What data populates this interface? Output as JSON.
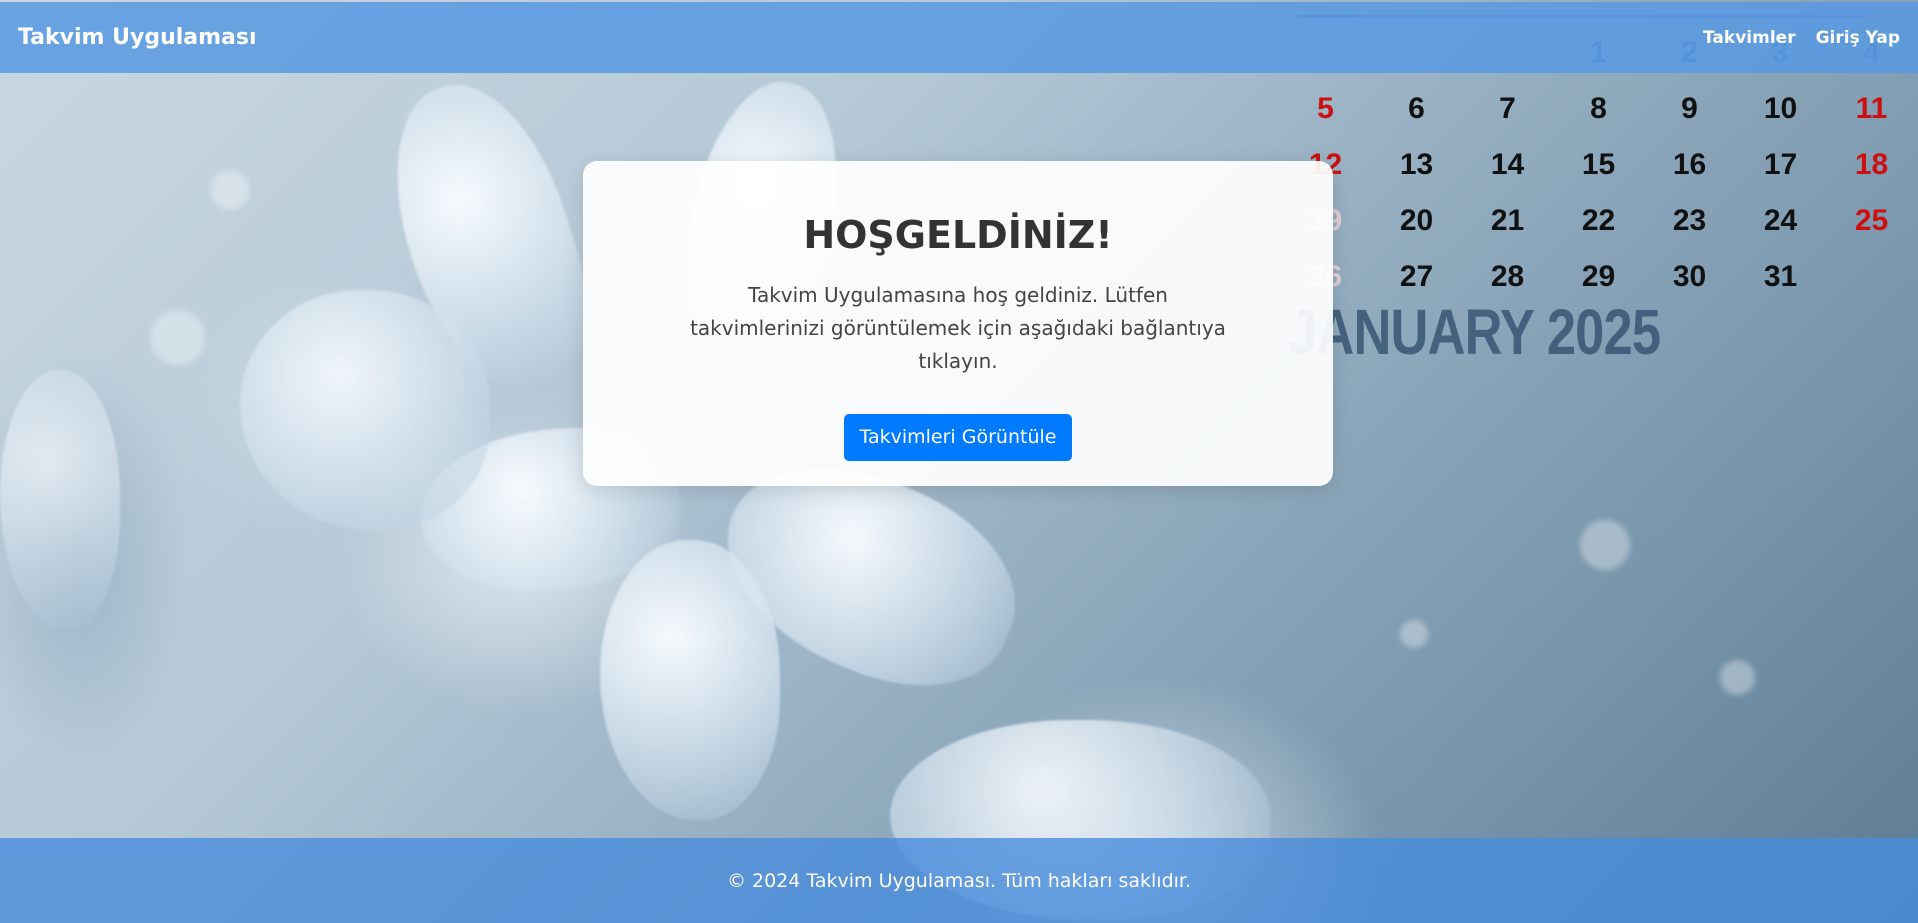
{
  "navbar": {
    "brand": "Takvim Uygulaması",
    "links": [
      "Takvimler",
      "Giriş Yap"
    ]
  },
  "calendar": {
    "top_row": [
      "",
      "",
      "",
      "1",
      "2",
      "3",
      "4"
    ],
    "rows": [
      [
        "5",
        "6",
        "7",
        "8",
        "9",
        "10",
        "11"
      ],
      [
        "12",
        "13",
        "14",
        "15",
        "16",
        "17",
        "18"
      ],
      [
        "19",
        "20",
        "21",
        "22",
        "23",
        "24",
        "25"
      ],
      [
        "26",
        "27",
        "28",
        "29",
        "30",
        "31",
        ""
      ]
    ],
    "title": "JANUARY 2025"
  },
  "card": {
    "title": "HOŞGELDİNİZ!",
    "text": "Takvim Uygulamasına hoş geldiniz. Lütfen takvimlerinizi görüntülemek için aşağıdaki bağlantıya tıklayın.",
    "button_label": "Takvimleri Görüntüle"
  },
  "footer": {
    "text": "© 2024 Takvim Uygulaması. Tüm hakları saklıdır."
  },
  "colors": {
    "navbar": "#5899e2",
    "button": "#007bff",
    "footer": "#468cdc",
    "holiday": "#cc1010"
  }
}
